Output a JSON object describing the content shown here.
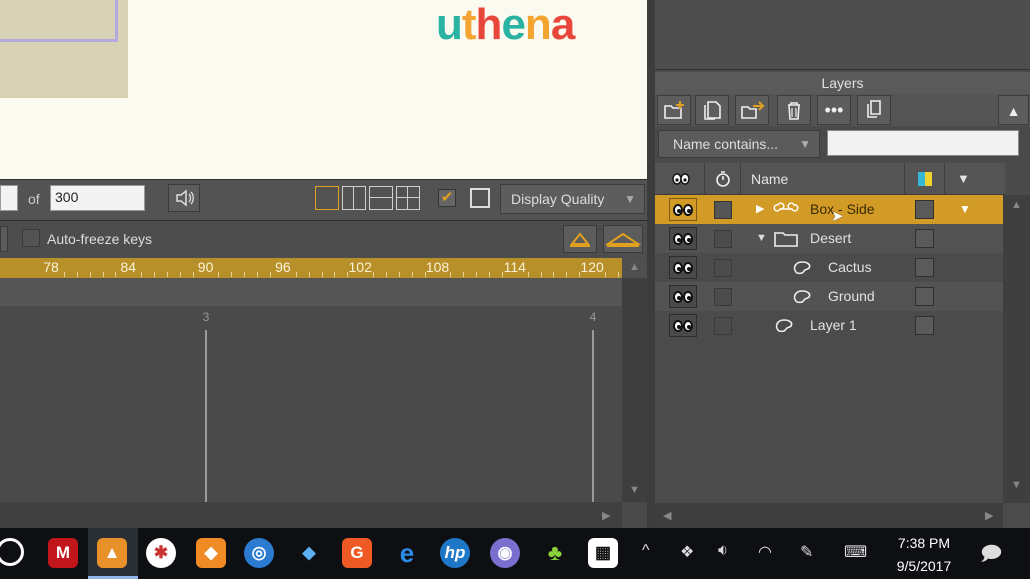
{
  "stage": {
    "logo_letters": [
      {
        "ch": "u",
        "color": "#2ab3a3"
      },
      {
        "ch": "t",
        "color": "#f4a531"
      },
      {
        "ch": "h",
        "color": "#e8463a"
      },
      {
        "ch": "e",
        "color": "#2ab3a3"
      },
      {
        "ch": "n",
        "color": "#f4a531"
      },
      {
        "ch": "a",
        "color": "#e8463a"
      }
    ]
  },
  "frame_bar": {
    "of_label": "of",
    "total_frames": "300",
    "sound_icon": "speaker-icon",
    "display_quality": "Display Quality",
    "display_quality_checked": true
  },
  "timeline": {
    "auto_freeze_label": "Auto-freeze keys",
    "ruler_ticks": [
      "78",
      "84",
      "90",
      "96",
      "102",
      "108",
      "114",
      "120"
    ],
    "markers": [
      "3",
      "4"
    ]
  },
  "layers": {
    "title": "Layers",
    "toolbar": [
      "new-layer-icon",
      "duplicate-layer-icon",
      "export-layer-icon",
      "delete-icon",
      "more-icon",
      "copy-icon"
    ],
    "filter_select": "Name contains...",
    "filter_value": "",
    "header_name": "Name",
    "rows": [
      {
        "name": "Box - Side",
        "type": "bone",
        "expand": "▶",
        "selected": true
      },
      {
        "name": "Desert",
        "type": "folder",
        "expand": "▼",
        "selected": false
      },
      {
        "name": "Cactus",
        "type": "vector",
        "expand": "",
        "selected": false
      },
      {
        "name": "Ground",
        "type": "vector",
        "expand": "",
        "selected": false
      },
      {
        "name": "Layer 1",
        "type": "vector",
        "expand": "",
        "selected": false
      }
    ]
  },
  "taskbar": {
    "time": "7:38 PM",
    "date": "9/5/2017",
    "accent_orange": "#d29b26"
  }
}
